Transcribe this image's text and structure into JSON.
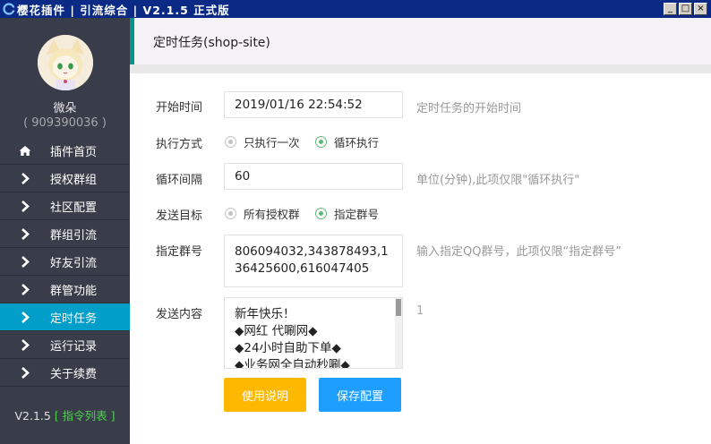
{
  "window": {
    "title": "樱花插件 | 引流综合 | V2.1.5 正式版",
    "buttons": [
      "_",
      "□",
      "×"
    ]
  },
  "sidebar": {
    "username": "微朵",
    "user_id": "( 909390036 )",
    "items": [
      {
        "label": "插件首页",
        "icon": "home-icon"
      },
      {
        "label": "授权群组",
        "icon": "chevron-right-icon"
      },
      {
        "label": "社区配置",
        "icon": "chevron-right-icon"
      },
      {
        "label": "群组引流",
        "icon": "chevron-right-icon"
      },
      {
        "label": "好友引流",
        "icon": "chevron-right-icon"
      },
      {
        "label": "群管功能",
        "icon": "chevron-right-icon"
      },
      {
        "label": "定时任务",
        "icon": "chevron-right-icon",
        "active": true
      },
      {
        "label": "运行记录",
        "icon": "chevron-right-icon"
      },
      {
        "label": "关于续费",
        "icon": "chevron-right-icon"
      }
    ],
    "version": "V2.1.5",
    "command_list": "[ 指令列表 ]"
  },
  "header": {
    "title": "定时任务(shop-site)"
  },
  "form": {
    "start_time": {
      "label": "开始时间",
      "value": "2019/01/16 22:54:52",
      "hint": "定时任务的开始时间"
    },
    "exec_mode": {
      "label": "执行方式",
      "options": [
        "只执行一次",
        "循环执行"
      ],
      "selected": "循环执行"
    },
    "interval": {
      "label": "循环间隔",
      "value": "60",
      "hint": "单位(分钟),此项仅限\"循环执行\""
    },
    "target": {
      "label": "发送目标",
      "options": [
        "所有授权群",
        "指定群号"
      ],
      "selected": "指定群号"
    },
    "groups": {
      "label": "指定群号",
      "value": "806094032,343878493,136425600,616047405",
      "hint": "输入指定QQ群号，此项仅限“指定群号”"
    },
    "content": {
      "label": "发送内容",
      "lines": [
        "新年快乐！",
        "◆网红 代唰网◆",
        "◆24小时自助下单◆",
        "◆业务网全自动秒唰◆"
      ],
      "counter": "1"
    }
  },
  "buttons": {
    "help": "使用说明",
    "save": "保存配置"
  },
  "colors": {
    "titlebar": "#0a2a86",
    "sidebar": "#393d49",
    "active_item": "#009ec9",
    "accent_border": "#009688",
    "radio_checked": "#5fb878",
    "help_button": "#ffb800",
    "save_button": "#1e9fff",
    "command_link": "#4fd14f"
  }
}
